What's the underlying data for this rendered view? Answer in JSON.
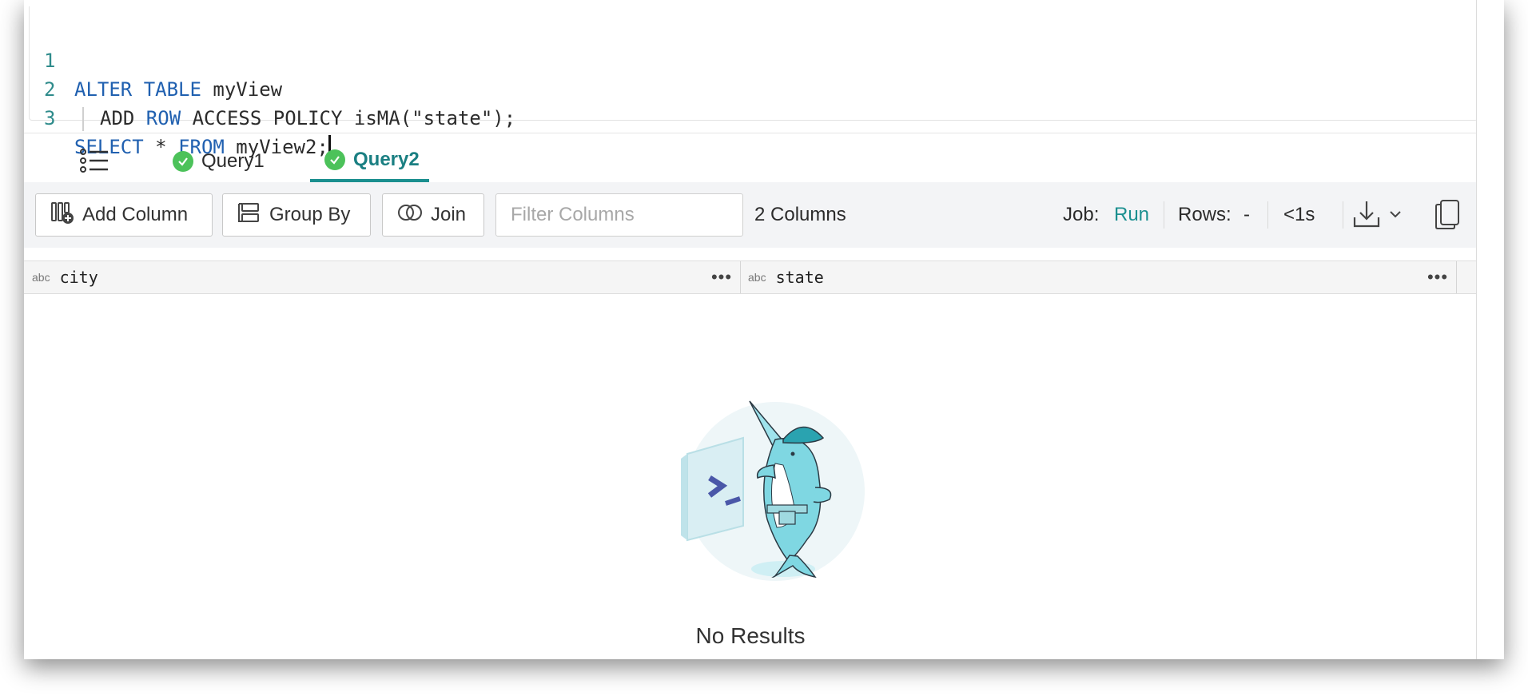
{
  "editor": {
    "lines": [
      {
        "num": "1",
        "kw1": "ALTER TABLE",
        "rest1": " myView"
      },
      {
        "num": "2",
        "t1": "ADD ",
        "kw1": "ROW",
        "rest1": " ACCESS POLICY isMA(\"state\");"
      },
      {
        "num": "3",
        "kw1": "SELECT",
        "rest1": " * ",
        "kw2": "FROM",
        "rest2": " myView2;"
      }
    ]
  },
  "tabs": [
    {
      "label": "Query1",
      "status": "success"
    },
    {
      "label": "Query2",
      "status": "success",
      "active": true
    }
  ],
  "toolbar": {
    "add_column": "Add Column",
    "group_by": "Group By",
    "join": "Join",
    "filter_placeholder": "Filter Columns",
    "columns_count": "2 Columns",
    "job_label": "Job:",
    "job_value": "Run",
    "rows_label": "Rows:",
    "rows_value": "-",
    "duration": "<1s"
  },
  "grid": {
    "columns": [
      {
        "type": "abc",
        "name": "city"
      },
      {
        "type": "abc",
        "name": "state"
      }
    ]
  },
  "empty_state": {
    "title": "No Results"
  },
  "colors": {
    "accent": "#1a8f8f",
    "keyword": "#2060b0",
    "success": "#4cc25a"
  }
}
